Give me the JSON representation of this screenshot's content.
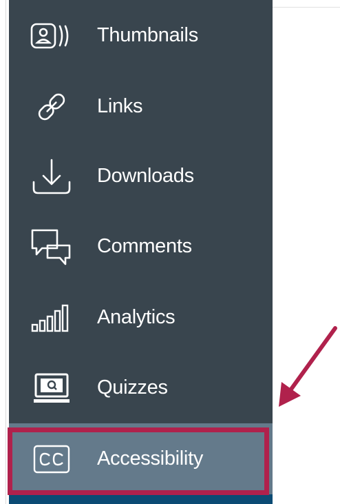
{
  "sidebar": {
    "items": [
      {
        "label": "Thumbnails",
        "icon": "thumbnails-icon"
      },
      {
        "label": "Links",
        "icon": "link-icon"
      },
      {
        "label": "Downloads",
        "icon": "download-icon"
      },
      {
        "label": "Comments",
        "icon": "comments-icon"
      },
      {
        "label": "Analytics",
        "icon": "analytics-icon"
      },
      {
        "label": "Quizzes",
        "icon": "quiz-icon"
      },
      {
        "label": "Accessibility",
        "icon": "closed-captions-icon",
        "active": true
      }
    ]
  },
  "colors": {
    "sidebar_bg": "#39454e",
    "active_bg": "#647a8b",
    "highlight": "#b0214c",
    "text": "#ffffff",
    "bottom_strip": "#0b4b74"
  },
  "annotation": {
    "arrow_icon": "arrow-pointer-icon"
  }
}
